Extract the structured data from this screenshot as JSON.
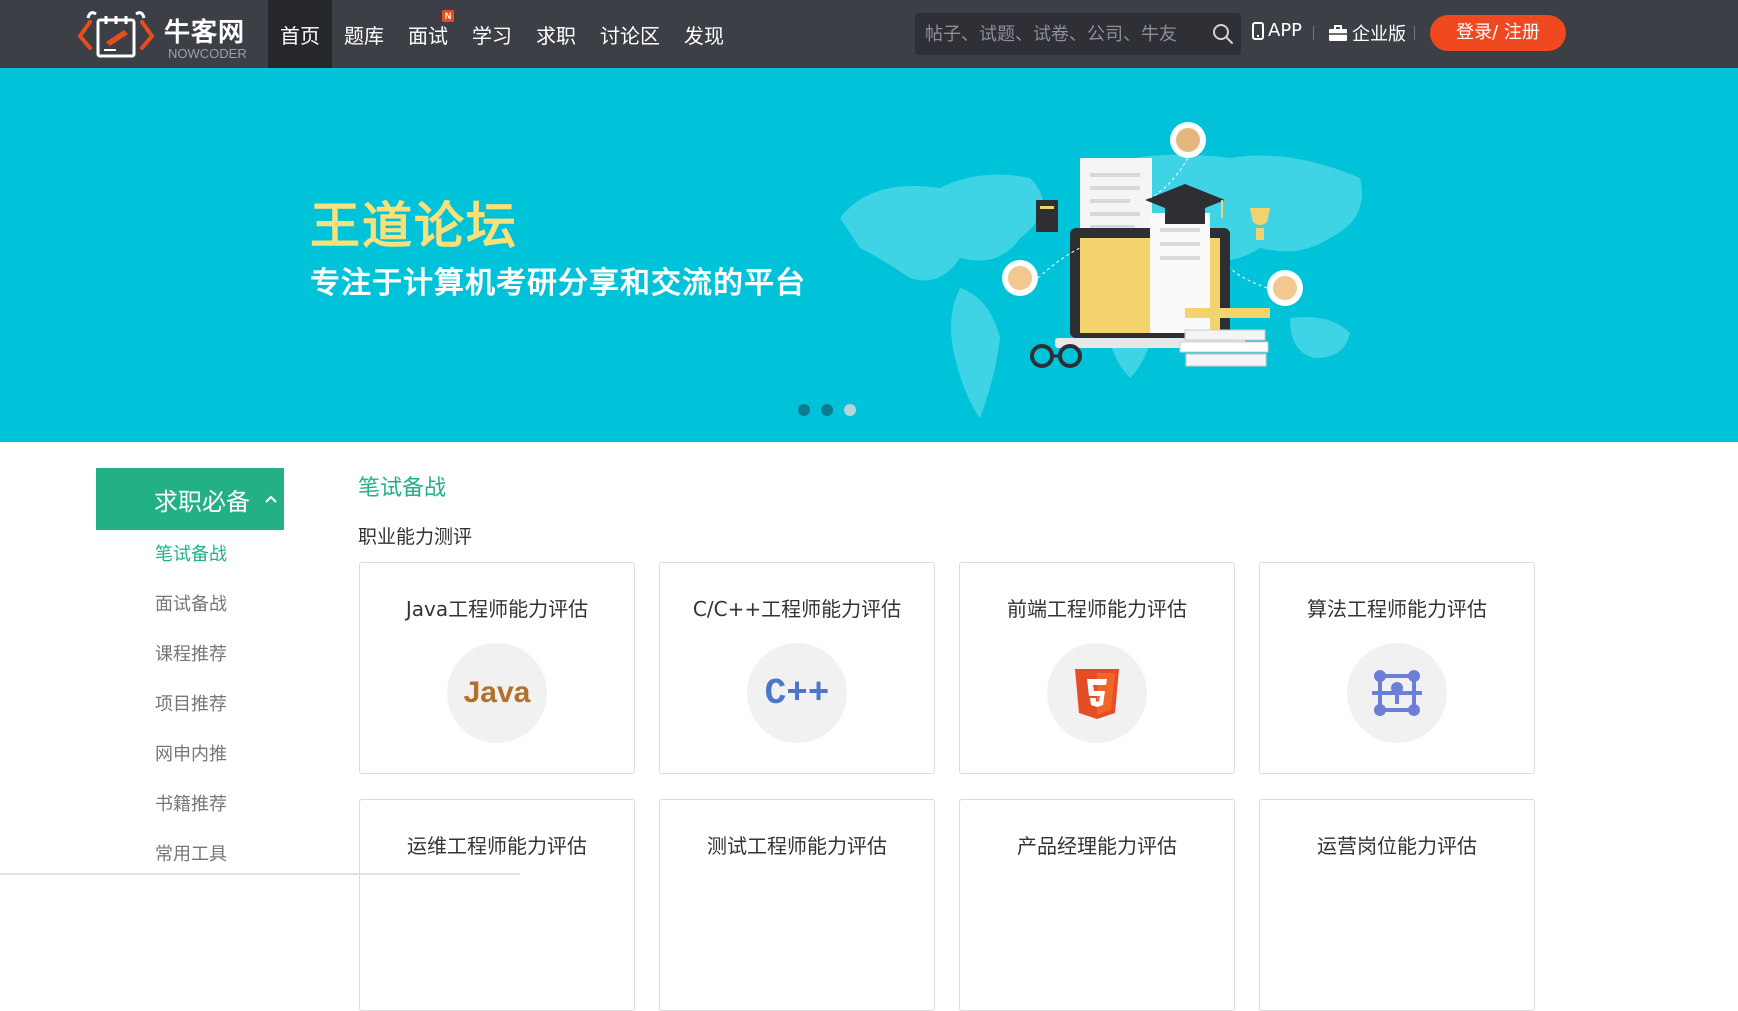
{
  "header": {
    "logo_cn": "牛客网",
    "logo_en": "NOWCODER",
    "nav": [
      {
        "label": "首页",
        "active": true
      },
      {
        "label": "题库"
      },
      {
        "label": "面试",
        "badge": "N"
      },
      {
        "label": "学习"
      },
      {
        "label": "求职"
      },
      {
        "label": "讨论区"
      },
      {
        "label": "发现"
      }
    ],
    "search_placeholder": "帖子、试题、试卷、公司、牛友",
    "app_label": "APP",
    "enterprise_label": "企业版",
    "login_label": "登录/ 注册"
  },
  "banner": {
    "title": "王道论坛",
    "subtitle": "专注于计算机考研分享和交流的平台",
    "slide_count": 3,
    "active_slide": 3,
    "background_color": "#00c3d9"
  },
  "sidebar": {
    "heading": "求职必备",
    "items": [
      "笔试备战",
      "面试备战",
      "课程推荐",
      "项目推荐",
      "网申内推",
      "书籍推荐",
      "常用工具"
    ],
    "active_index": 0
  },
  "main": {
    "section_title": "笔试备战",
    "subsection_title": "职业能力测评",
    "cards": [
      {
        "label": "Java工程师能力评估",
        "icon": "java-icon",
        "icon_text": "Java"
      },
      {
        "label": "C/C++工程师能力评估",
        "icon": "cpp-icon",
        "icon_text": "C++"
      },
      {
        "label": "前端工程师能力评估",
        "icon": "html5-icon"
      },
      {
        "label": "算法工程师能力评估",
        "icon": "algorithm-icon"
      },
      {
        "label": "运维工程师能力评估"
      },
      {
        "label": "测试工程师能力评估"
      },
      {
        "label": "产品经理能力评估"
      },
      {
        "label": "运营岗位能力评估"
      }
    ]
  },
  "colors": {
    "accent_green": "#24b086",
    "login_red": "#f0481f",
    "topbar": "#3c3f45"
  }
}
